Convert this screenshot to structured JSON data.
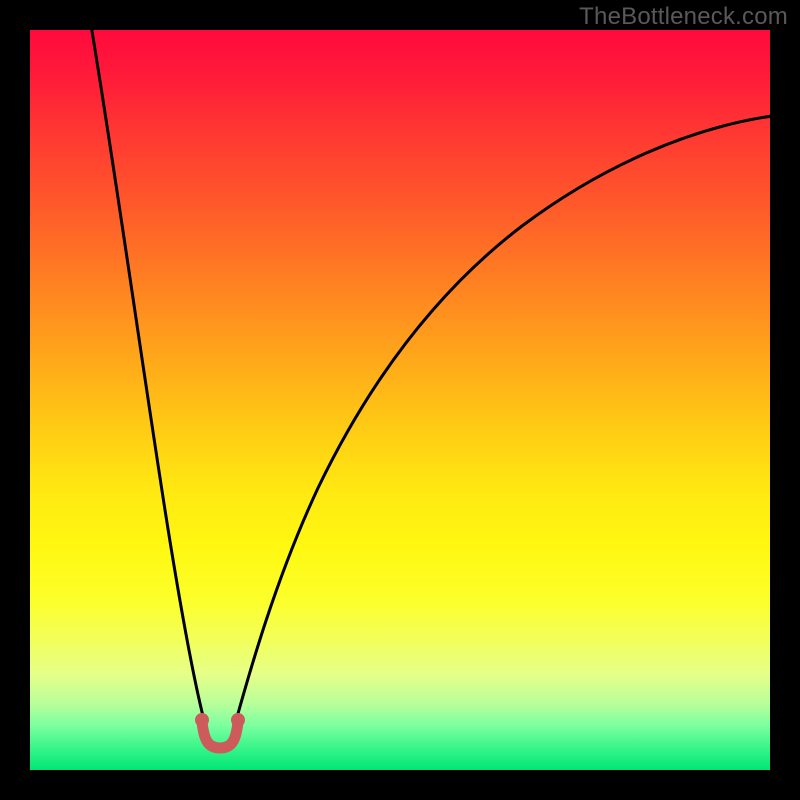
{
  "watermark": "TheBottleneck.com",
  "chart_data": {
    "type": "line",
    "title": "",
    "xlabel": "",
    "ylabel": "",
    "axes_visible": false,
    "grid": false,
    "background": "vertical red→yellow→green heat gradient",
    "notch": {
      "x_position_fraction": 0.24,
      "y_floor_fraction": 0.97
    },
    "series": [
      {
        "name": "left-descending-curve",
        "description": "steep convex curve entering from top-left, plunging to the lower notch",
        "stroke": "#000000"
      },
      {
        "name": "right-ascending-curve",
        "description": "curve rising from the notch toward upper-right, flattening gradually",
        "stroke": "#000000"
      },
      {
        "name": "notch-marker",
        "description": "small U-shaped red marker with two dot endpoints at the valley floor",
        "stroke": "#ce5b5b"
      }
    ],
    "gradient_stops": [
      {
        "pct": 0,
        "color": "#ff0a3c"
      },
      {
        "pct": 24,
        "color": "#ff5a2a"
      },
      {
        "pct": 54,
        "color": "#ffcc14"
      },
      {
        "pct": 77,
        "color": "#fcff2a"
      },
      {
        "pct": 91,
        "color": "#b8ff9a"
      },
      {
        "pct": 100,
        "color": "#00e676"
      }
    ]
  }
}
